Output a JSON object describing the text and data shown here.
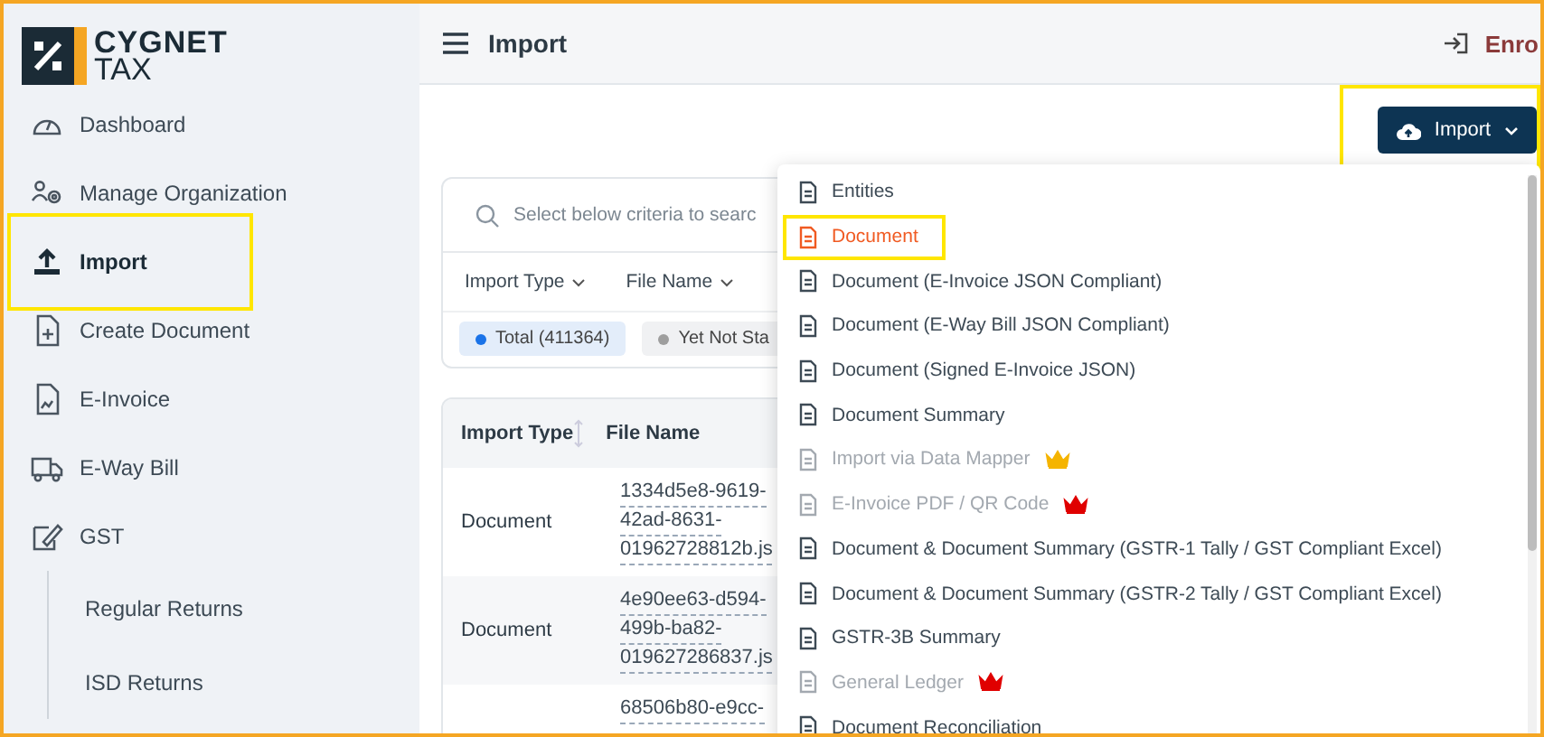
{
  "logo": {
    "line_1": "CYGNET",
    "line_2": "TAX"
  },
  "sidebar": {
    "items": [
      {
        "label": "Dashboard",
        "selected": false,
        "highlighted": false
      },
      {
        "label": "Manage Organization",
        "selected": false,
        "highlighted": false
      },
      {
        "label": "Import",
        "selected": true,
        "highlighted": true
      },
      {
        "label": "Create Document",
        "selected": false,
        "highlighted": false
      },
      {
        "label": "E-Invoice",
        "selected": false,
        "highlighted": false
      },
      {
        "label": "E-Way Bill",
        "selected": false,
        "highlighted": false
      },
      {
        "label": "GST",
        "selected": false,
        "highlighted": false,
        "children": [
          {
            "label": "Regular Returns",
            "selected": false
          },
          {
            "label": "ISD Returns",
            "selected": false
          }
        ]
      }
    ]
  },
  "header": {
    "title": "Import",
    "action": "Enro"
  },
  "import_button": {
    "label": "Import",
    "highlighted": true
  },
  "search": {
    "placeholder": "Select below criteria to searc"
  },
  "filters": [
    "Import Type",
    "File Name"
  ],
  "chips": [
    {
      "label": "Total (411364)",
      "selected": true,
      "color": "#1a73e8"
    },
    {
      "label": "Yet Not Sta",
      "selected": false,
      "color": "#9e9e9e"
    }
  ],
  "table": {
    "columns": [
      "Import Type",
      "File Name"
    ],
    "rows": [
      {
        "import_type": "Document",
        "file_name": [
          "1334d5e8-9619-",
          "42ad-8631-",
          "01962728812b.js"
        ]
      },
      {
        "import_type": "Document",
        "file_name": [
          "4e90ee63-d594-",
          "499b-ba82-",
          "019627286837.js"
        ]
      },
      {
        "file_name": [
          "68506b80-e9cc-"
        ]
      }
    ]
  },
  "menu": {
    "items": [
      {
        "label": "Entities",
        "selected": false,
        "disabled": false,
        "highlighted": false
      },
      {
        "label": "Document",
        "selected": true,
        "disabled": false,
        "highlighted": true
      },
      {
        "label": "Document (E-Invoice JSON Compliant)",
        "selected": false,
        "disabled": false,
        "highlighted": false
      },
      {
        "label": "Document (E-Way Bill JSON Compliant)",
        "selected": false,
        "disabled": false,
        "highlighted": false
      },
      {
        "label": "Document (Signed E-Invoice JSON)",
        "selected": false,
        "disabled": false,
        "highlighted": false
      },
      {
        "label": "Document Summary",
        "selected": false,
        "disabled": false,
        "highlighted": false
      },
      {
        "label": "Import via Data Mapper",
        "selected": false,
        "disabled": true,
        "highlighted": false,
        "crown": {
          "color": "#f5b400"
        }
      },
      {
        "label": "E-Invoice PDF / QR Code",
        "selected": false,
        "disabled": true,
        "highlighted": false,
        "crown": {
          "color": "#e00000"
        }
      },
      {
        "label": "Document & Document Summary (GSTR-1 Tally / GST Compliant Excel)",
        "selected": false,
        "disabled": false,
        "highlighted": false
      },
      {
        "label": "Document & Document Summary (GSTR-2 Tally / GST Compliant Excel)",
        "selected": false,
        "disabled": false,
        "highlighted": false
      },
      {
        "label": "GSTR-3B Summary",
        "selected": false,
        "disabled": false,
        "highlighted": false
      },
      {
        "label": "General Ledger",
        "selected": false,
        "disabled": true,
        "highlighted": false,
        "crown": {
          "color": "#e00000"
        }
      },
      {
        "label": "Document Reconciliation",
        "selected": false,
        "disabled": false,
        "highlighted": false
      }
    ]
  }
}
